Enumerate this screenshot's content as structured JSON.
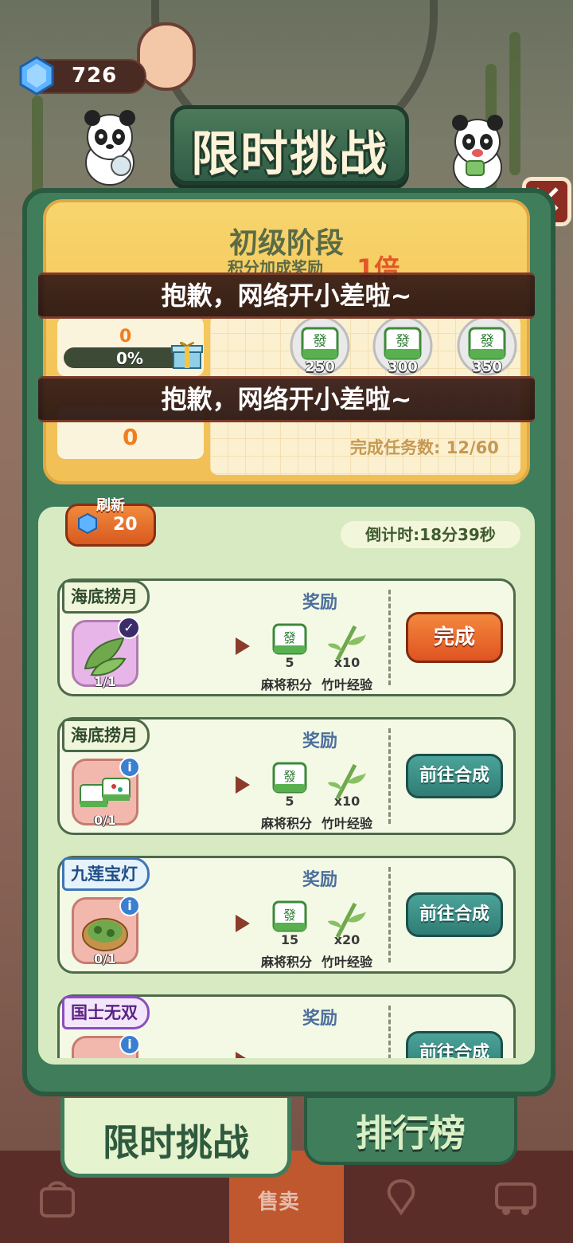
{
  "currency": {
    "gems": "726"
  },
  "title": "限时挑战",
  "stage": {
    "name": "初级阶段",
    "bonus_label": "积分加成奖励",
    "bonus_multiplier": "1倍",
    "my_score": "0",
    "progress_text": "0%",
    "progress_fraction": 0,
    "my_rank": "0",
    "milestones": [
      "250",
      "300",
      "350"
    ],
    "tasks_done_label": "完成任务数:",
    "tasks_done_value": "12/60"
  },
  "toasts": [
    "抱歉，网络开小差啦~",
    "抱歉，网络开小差啦~"
  ],
  "refresh": {
    "label": "刷新",
    "cost": "20"
  },
  "countdown": "倒计时:18分39秒",
  "reward_header": "奖励",
  "reward_names": {
    "mahjong": "麻将积分",
    "bamboo": "竹叶经验"
  },
  "tasks": [
    {
      "tag": "海底捞月",
      "progress": "1/1",
      "mahjong": "5",
      "bamboo": "x10",
      "button": "完成"
    },
    {
      "tag": "海底捞月",
      "progress": "0/1",
      "mahjong": "5",
      "bamboo": "x10",
      "button": "前往合成"
    },
    {
      "tag": "九莲宝灯",
      "progress": "0/1",
      "mahjong": "15",
      "bamboo": "x20",
      "button": "前往合成"
    },
    {
      "tag": "国士无双",
      "progress": "",
      "mahjong": "",
      "bamboo": "",
      "button": "前往合成"
    }
  ],
  "tabs": {
    "active": "限时挑战",
    "inactive": "排行榜"
  },
  "bottom_nav": {
    "sell": "售卖"
  },
  "colors": {
    "panel_green": "#3f7d5b",
    "accent_orange": "#e05322",
    "teal_button": "#2f7d74"
  }
}
